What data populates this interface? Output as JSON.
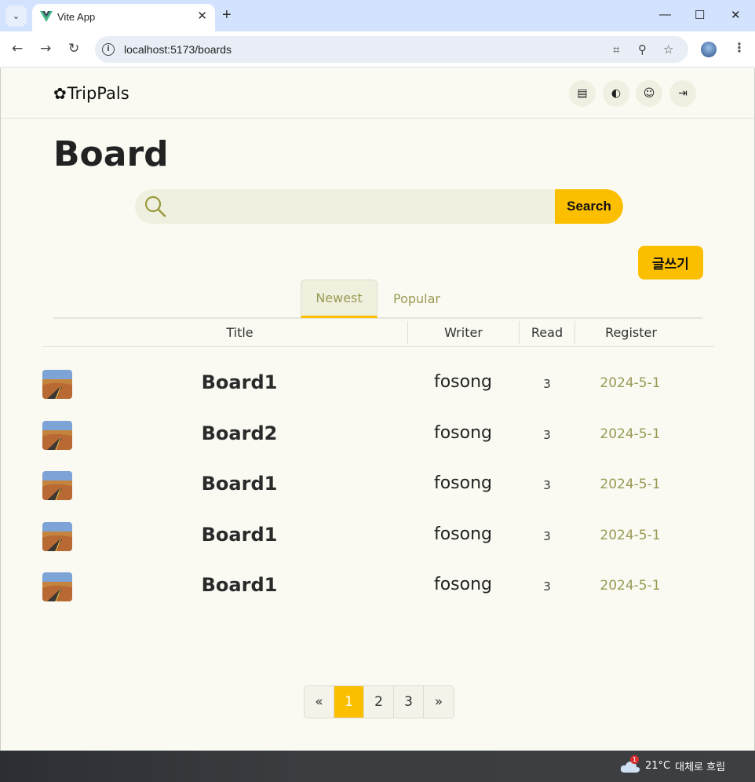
{
  "browser": {
    "tab_title": "Vite App",
    "url": "localhost:5173/boards",
    "new_tab": "+",
    "close_tab": "✕",
    "minimize": "—",
    "maximize": "☐",
    "close_window": "✕"
  },
  "header": {
    "logo_text": "TripPals",
    "icons": [
      "notes-icon",
      "globe-icon",
      "user-icon",
      "logout-icon"
    ]
  },
  "page": {
    "title": "Board",
    "search_placeholder": "",
    "search_button": "Search",
    "write_button": "글쓰기"
  },
  "tabs": [
    {
      "label": "Newest",
      "active": true
    },
    {
      "label": "Popular",
      "active": false
    }
  ],
  "table": {
    "headers": [
      "Title",
      "Writer",
      "Read",
      "Register"
    ],
    "rows": [
      {
        "title": "Board1",
        "writer": "fosong",
        "read": "3",
        "date": "2024-5-1"
      },
      {
        "title": "Board2",
        "writer": "fosong",
        "read": "3",
        "date": "2024-5-1"
      },
      {
        "title": "Board1",
        "writer": "fosong",
        "read": "3",
        "date": "2024-5-1"
      },
      {
        "title": "Board1",
        "writer": "fosong",
        "read": "3",
        "date": "2024-5-1"
      },
      {
        "title": "Board1",
        "writer": "fosong",
        "read": "3",
        "date": "2024-5-1"
      }
    ]
  },
  "pagination": {
    "prev": "«",
    "pages": [
      "1",
      "2",
      "3"
    ],
    "current": "1",
    "next": "»"
  },
  "taskbar": {
    "weather_badge": "1",
    "temperature": "21°C",
    "condition": "대체로 흐림"
  },
  "colors": {
    "accent": "#fcbf00",
    "page_bg": "#fafaf3",
    "muted_text": "#9a9a55"
  }
}
